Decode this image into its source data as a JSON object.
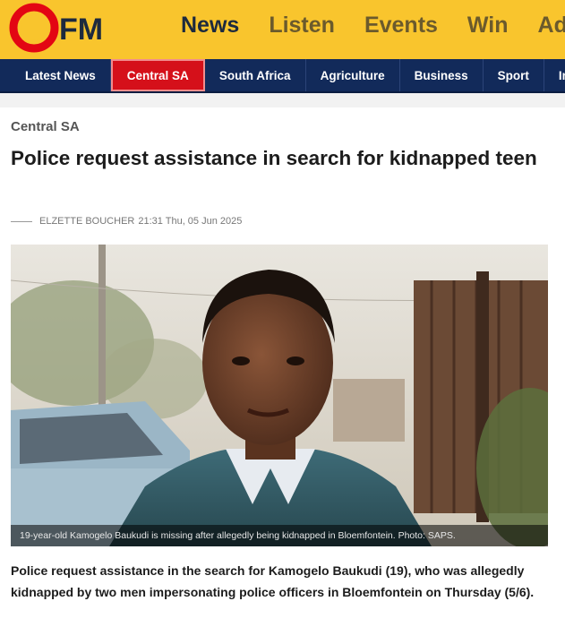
{
  "brand": {
    "logo_text": "OFM",
    "colors": {
      "header_bg": "#f9c52d",
      "logo_red": "#e30613",
      "nav_bg": "#122a5a",
      "active_red": "#d5101a"
    }
  },
  "topnav": {
    "items": [
      {
        "label": "News"
      },
      {
        "label": "Listen"
      },
      {
        "label": "Events"
      },
      {
        "label": "Win"
      },
      {
        "label": "Adve"
      }
    ]
  },
  "catnav": {
    "items": [
      {
        "label": "Latest News"
      },
      {
        "label": "Central SA"
      },
      {
        "label": "South Africa"
      },
      {
        "label": "Agriculture"
      },
      {
        "label": "Business"
      },
      {
        "label": "Sport"
      },
      {
        "label": "Interna"
      }
    ]
  },
  "article": {
    "category": "Central SA",
    "title": "Police request assistance in search for kidnapped teen",
    "author": "ELZETTE BOUCHER",
    "datetime": "21:31 Thu, 05 Jun 2025",
    "image_caption": "19-year-old Kamogelo Baukudi is missing after allegedly being kidnapped in Bloemfontein. Photo: SAPS.",
    "lead": "Police request assistance in the search for Kamogelo Baukudi (19), who was allegedly kidnapped by two men impersonating police officers in Bloemfontein on Thursday (5/6)."
  }
}
